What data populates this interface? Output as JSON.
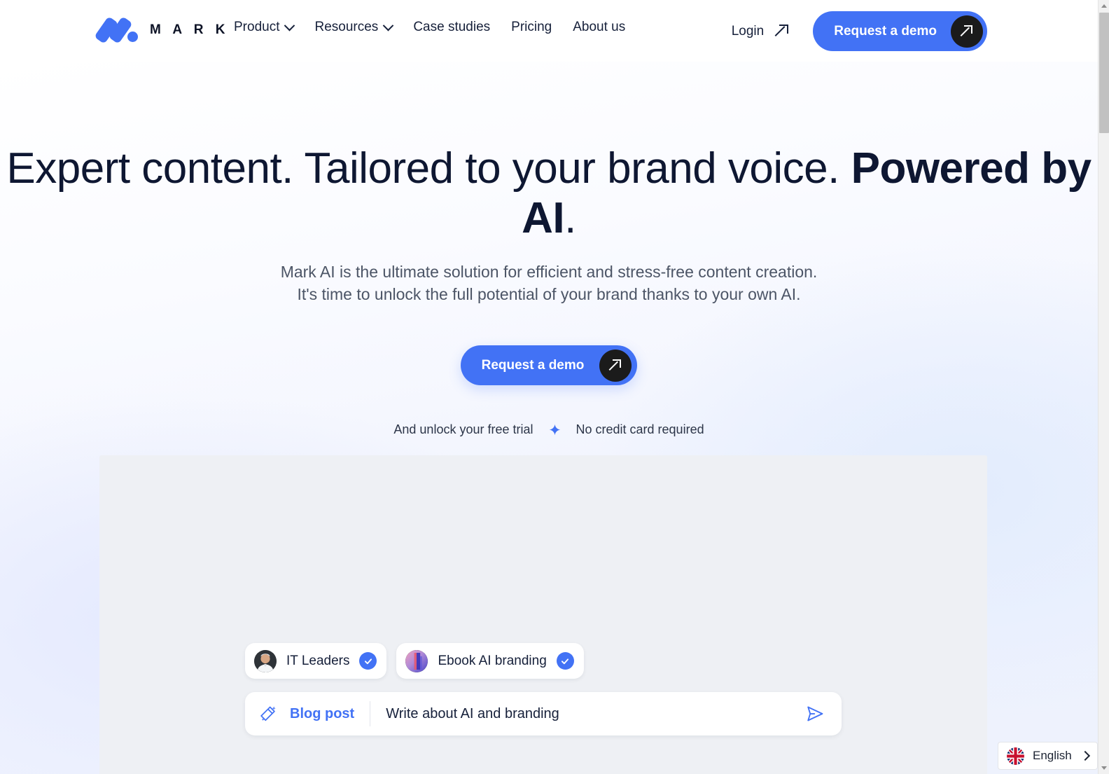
{
  "nav": {
    "brand_word": "M A R K",
    "logo_icon": "mark-logo-icon",
    "links": [
      {
        "label": "Product",
        "has_dropdown": true
      },
      {
        "label": "Resources",
        "has_dropdown": true
      },
      {
        "label": "Case studies",
        "has_dropdown": false
      },
      {
        "label": "Pricing",
        "has_dropdown": false
      },
      {
        "label": "About us",
        "has_dropdown": false
      }
    ],
    "login_label": "Login",
    "login_icon": "arrow-up-right-icon",
    "demo_button_label": "Request a demo",
    "demo_button_icon": "arrow-up-right-icon"
  },
  "hero": {
    "headline_part1": "Expert content. Tailored to your brand voice. ",
    "headline_bold": "Powered by AI",
    "headline_end": ".",
    "subhead_line1": "Mark AI is the ultimate solution for efficient and stress-free content creation.",
    "subhead_line2": "It's time to unlock the full potential of your brand thanks to your own AI.",
    "cta_label": "Request a demo",
    "cta_icon": "arrow-up-right-icon",
    "trial_text": "And unlock your free trial",
    "trial_separator_icon": "sparkle-icon",
    "trial_note": "No credit card required"
  },
  "app_mock": {
    "chips": [
      {
        "label": "IT Leaders",
        "icon": "person-avatar",
        "checked_icon": "check-circle-icon"
      },
      {
        "label": "Ebook AI branding",
        "icon": "ebook-gradient-icon",
        "checked_icon": "check-circle-icon"
      }
    ],
    "prompt": {
      "wand_icon": "magic-wand-icon",
      "type_label": "Blog post",
      "value": "Write about AI and branding",
      "placeholder": "Write about AI and branding",
      "send_icon": "send-plane-icon"
    }
  },
  "language_widget": {
    "flag_icon": "uk-flag-icon",
    "label": "English",
    "chevron_icon": "chevron-right-icon"
  },
  "colors": {
    "accent_blue": "#4272f5",
    "dark": "#0e1732",
    "panel_gray": "#eef0f4",
    "muted_text": "#4c5566"
  }
}
